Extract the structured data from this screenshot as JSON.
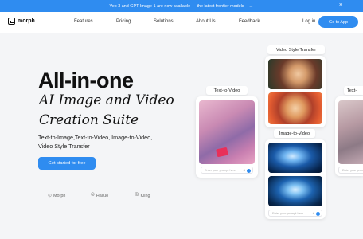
{
  "announcement": {
    "text": "Veo 3 and GPT-Image-1 are now available — the latest frontier models",
    "arrow": "→",
    "close": "×"
  },
  "nav": {
    "logo": "morph",
    "links": [
      "Features",
      "Pricing",
      "Solutions",
      "About Us",
      "Feedback"
    ],
    "login": "Log in",
    "go_to_app": "Go to App"
  },
  "hero": {
    "title": "All-in-one",
    "script_line1": "AI Image and Video",
    "script_line2": "Creation Suite",
    "subtitle_line1": "Text-to-Image,Text-to-Video, Image-to-Video,",
    "subtitle_line2": "Video Style Transfer",
    "cta": "Get started for free"
  },
  "partners": [
    "Morph",
    "Hailuo",
    "Kling"
  ],
  "cards": {
    "text_to_video": {
      "label": "Text-to-Video",
      "placeholder": "Enter your prompt here"
    },
    "video_style_transfer": {
      "label": "Video Style Transfer"
    },
    "image_to_video": {
      "label": "Image-to-Video",
      "placeholder": "Enter your prompt here"
    },
    "text_to_edge": {
      "label": "Text-",
      "placeholder": "Enter your prompt here"
    }
  },
  "colors": {
    "accent": "#2f8cf0",
    "background": "#f4f5f7"
  }
}
